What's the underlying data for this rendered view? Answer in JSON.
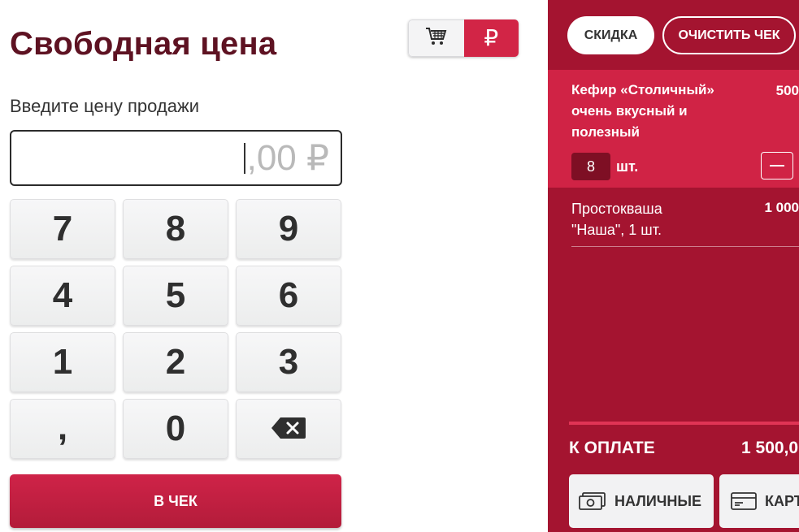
{
  "page": {
    "title": "Свободная цена",
    "price_label": "Введите цену продажи",
    "price_value": ",00 ₽"
  },
  "mode_toggle": {
    "cart_icon": "cart-icon",
    "ruble_icon": "ruble-icon",
    "ruble_symbol": "₽",
    "active": "ruble"
  },
  "keypad": {
    "k7": "7",
    "k8": "8",
    "k9": "9",
    "k4": "4",
    "k5": "5",
    "k6": "6",
    "k1": "1",
    "k2": "2",
    "k3": "3",
    "comma": ",",
    "k0": "0",
    "backspace_icon": "backspace-icon"
  },
  "actions": {
    "to_check": "В ЧЕК"
  },
  "receipt": {
    "discount": "СКИДКА",
    "clear": "ОЧИСТИТЬ ЧЕК",
    "items": [
      {
        "name": "Кефир «Столичный» очень вкусный и полезный",
        "price": "500",
        "qty": "8",
        "unit": "шт."
      },
      {
        "name": "Простокваша \"Наша\", 1 шт.",
        "price": "1 000"
      }
    ],
    "total_label": "К ОПЛАТЕ",
    "total_value": "1 500,0",
    "pay_cash": "НАЛИЧНЫЕ",
    "pay_card": "КАРТ"
  },
  "colors": {
    "brand_dark": "#5e1222",
    "accent": "#d22546",
    "receipt_bg": "#a41430",
    "active_item": "#d02345",
    "qty_bg": "#7e0f24"
  }
}
